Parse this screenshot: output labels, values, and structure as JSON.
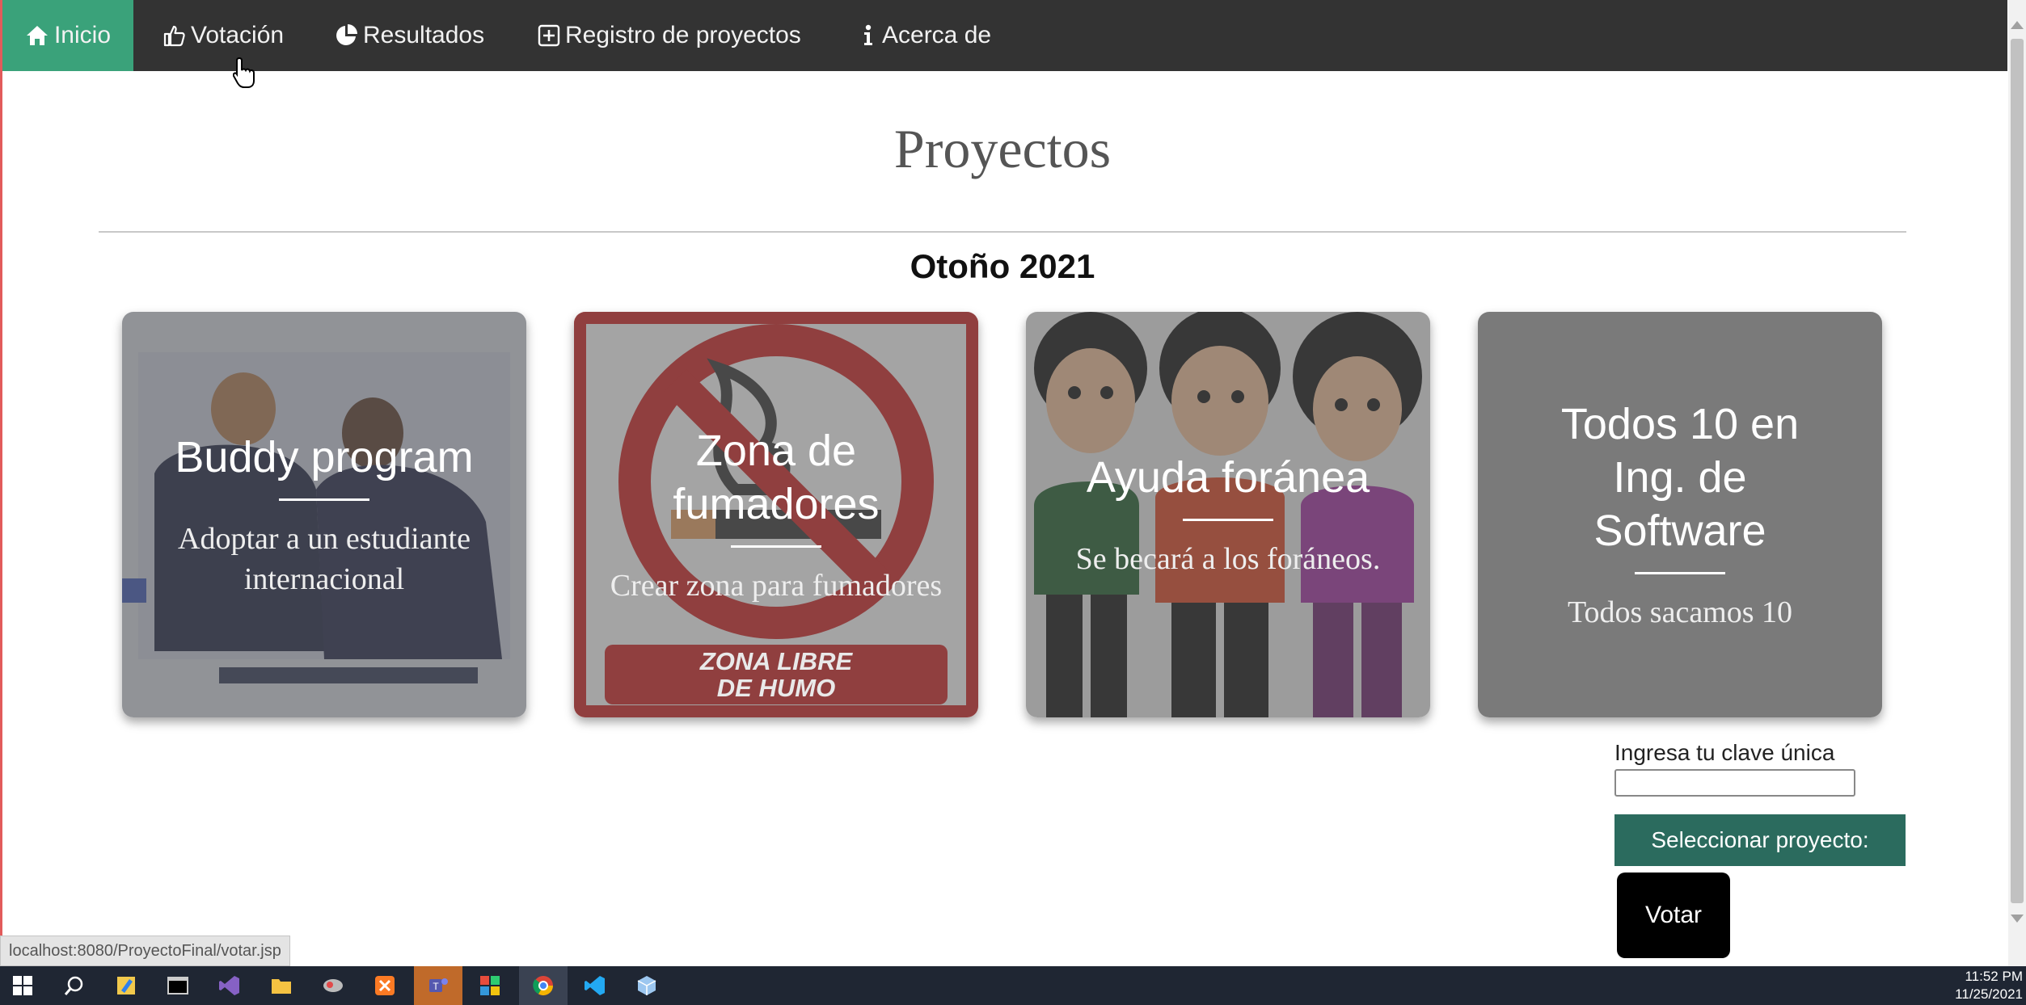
{
  "nav": {
    "items": [
      {
        "label": "Inicio",
        "icon": "home-icon",
        "active": true
      },
      {
        "label": "Votación",
        "icon": "thumbs-up-icon",
        "active": false
      },
      {
        "label": "Resultados",
        "icon": "pie-chart-icon",
        "active": false
      },
      {
        "label": "Registro de proyectos",
        "icon": "plus-square-icon",
        "active": false
      },
      {
        "label": "Acerca de",
        "icon": "info-icon",
        "active": false
      }
    ]
  },
  "main": {
    "title": "Proyectos",
    "season": "Otoño 2021",
    "cards": [
      {
        "title": "Buddy program",
        "description": "Adoptar a un estudiante internacional"
      },
      {
        "title": "Zona de fumadores",
        "description": "Crear zona para fumadores",
        "image_text": "ZONA LIBRE DE HUMO"
      },
      {
        "title": "Ayuda foránea",
        "description": "Se becará a los foráneos."
      },
      {
        "title": "Todos 10 en Ing. de Software",
        "description": "Todos sacamos 10"
      }
    ]
  },
  "form": {
    "key_label": "Ingresa tu clave única",
    "key_value": "",
    "select_label": "Seleccionar proyecto:",
    "vote_label": "Votar"
  },
  "status_bar": {
    "url": "localhost:8080/ProyectoFinal/votar.jsp"
  },
  "taskbar": {
    "time": "11:52 PM",
    "date": "11/25/2021"
  },
  "colors": {
    "nav_bg": "#333333",
    "nav_active": "#3aa27a",
    "select_btn": "#2b6b5e",
    "vote_btn": "#000000"
  }
}
